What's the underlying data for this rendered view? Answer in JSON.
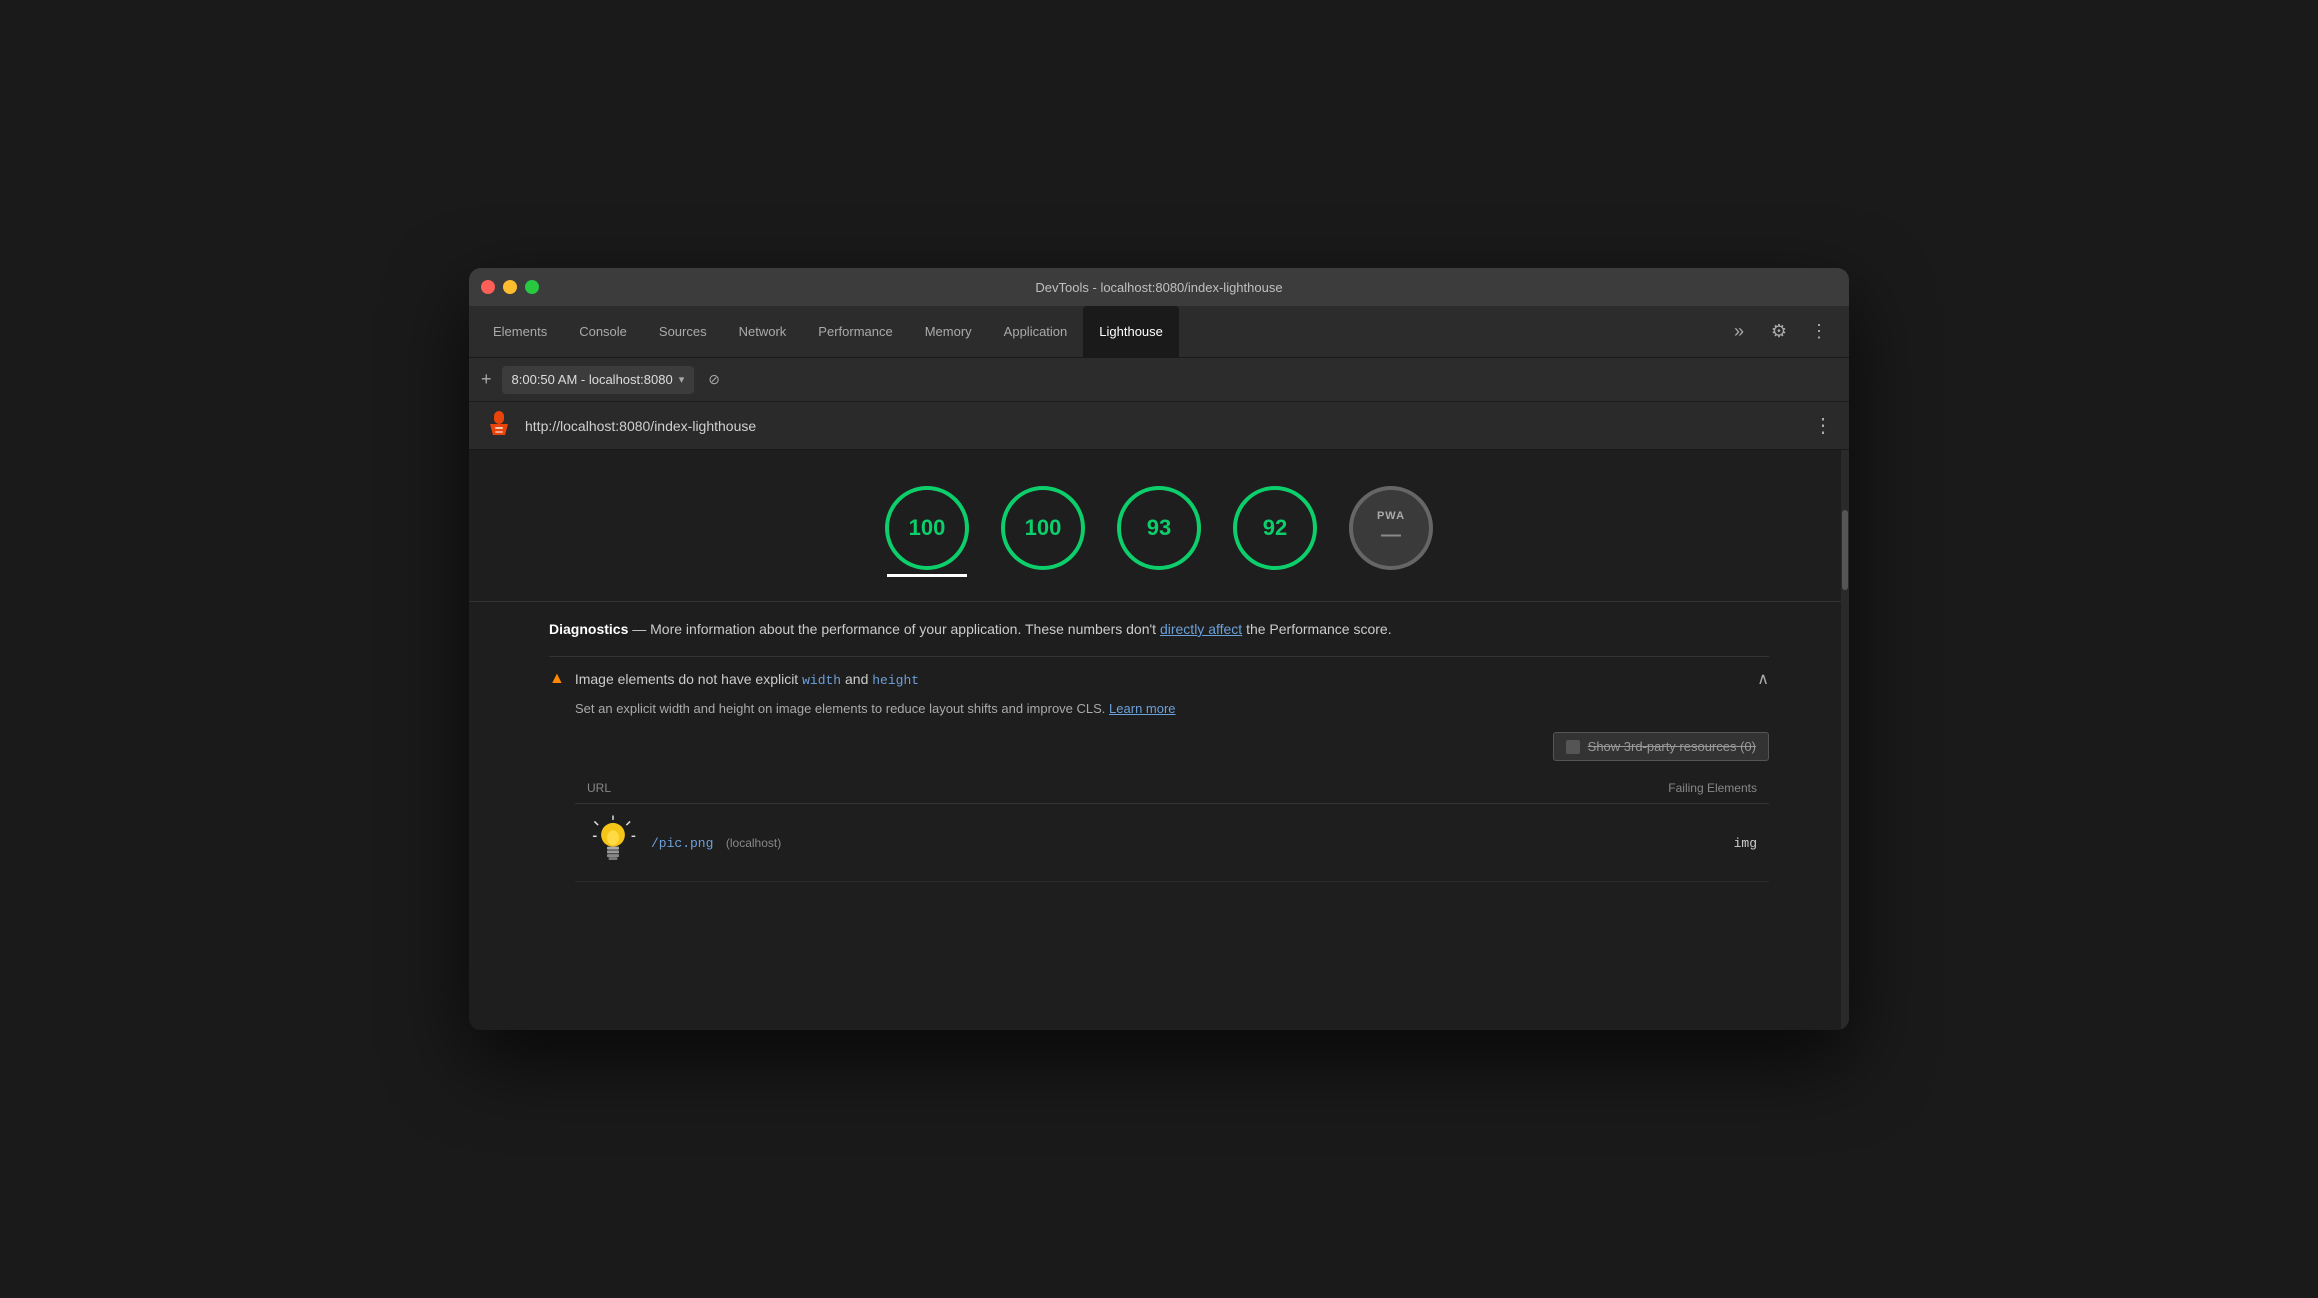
{
  "window": {
    "title": "DevTools - localhost:8080/index-lighthouse"
  },
  "traffic_lights": {
    "close": "close",
    "minimize": "minimize",
    "maximize": "maximize"
  },
  "tabs": [
    {
      "id": "elements",
      "label": "Elements",
      "active": false
    },
    {
      "id": "console",
      "label": "Console",
      "active": false
    },
    {
      "id": "sources",
      "label": "Sources",
      "active": false
    },
    {
      "id": "network",
      "label": "Network",
      "active": false
    },
    {
      "id": "performance",
      "label": "Performance",
      "active": false
    },
    {
      "id": "memory",
      "label": "Memory",
      "active": false
    },
    {
      "id": "application",
      "label": "Application",
      "active": false
    },
    {
      "id": "lighthouse",
      "label": "Lighthouse",
      "active": true
    }
  ],
  "tabs_more": "»",
  "settings_icon": "⚙",
  "more_icon": "⋮",
  "address_bar": {
    "add_label": "+",
    "address": "8:00:50 AM - localhost:8080",
    "dropdown": "▾",
    "block_icon": "⊘"
  },
  "lh_url_bar": {
    "url": "http://localhost:8080/index-lighthouse",
    "more_icon": "⋮"
  },
  "scores": [
    {
      "value": "100",
      "type": "green",
      "underline": true
    },
    {
      "value": "100",
      "type": "green",
      "underline": false
    },
    {
      "value": "93",
      "type": "green",
      "underline": false
    },
    {
      "value": "92",
      "type": "green",
      "underline": false
    },
    {
      "value": "PWA",
      "type": "pwa",
      "dash": "—",
      "underline": false
    }
  ],
  "diagnostics": {
    "title": "Diagnostics",
    "separator": "—",
    "description": "More information about the performance of your application. These numbers don't",
    "link_text": "directly affect",
    "description_end": "the Performance score."
  },
  "warning": {
    "icon": "▲",
    "title_start": "Image elements do not have explicit",
    "code1": "width",
    "and": "and",
    "code2": "height",
    "chevron": "∧",
    "description": "Set an explicit width and height on image elements to reduce layout shifts and improve CLS.",
    "learn_more": "Learn more",
    "third_party_label": "Show 3rd-party resources (0)",
    "table": {
      "col_url": "URL",
      "col_failing": "Failing Elements",
      "rows": [
        {
          "thumbnail": "lightbulb",
          "url": "/pic.png",
          "host": "(localhost)",
          "failing": "img"
        }
      ]
    }
  },
  "colors": {
    "green_score": "#0cce6b",
    "warning_orange": "#ff8800",
    "link_blue": "#6ca0d9",
    "bg_main": "#1e1e1e",
    "bg_window": "#2c2c2c"
  }
}
